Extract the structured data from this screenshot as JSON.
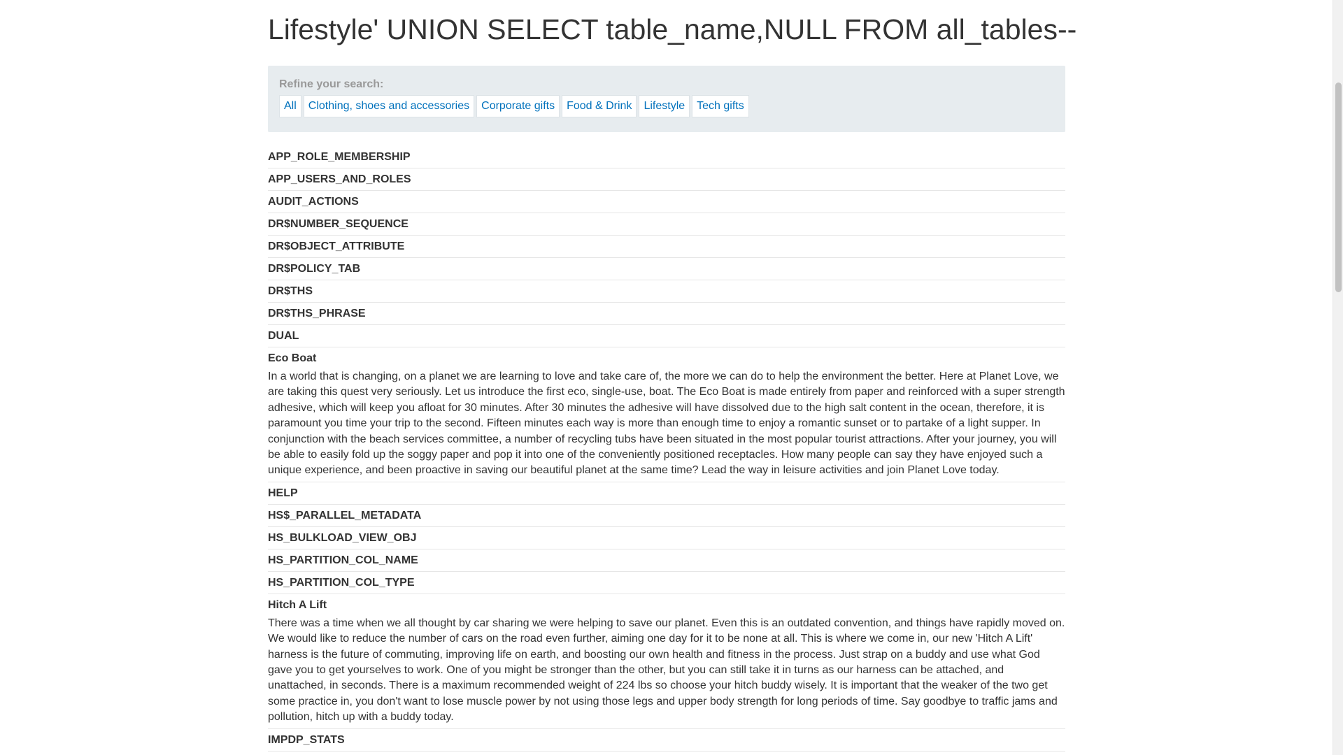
{
  "page": {
    "title": "Lifestyle' UNION SELECT table_name,NULL FROM all_tables--"
  },
  "refine": {
    "label": "Refine your search:",
    "filters": [
      "All",
      "Clothing, shoes and accessories",
      "Corporate gifts",
      "Food & Drink",
      "Lifestyle",
      "Tech gifts"
    ]
  },
  "results": [
    {
      "title": "APP_ROLE_MEMBERSHIP",
      "desc": ""
    },
    {
      "title": "APP_USERS_AND_ROLES",
      "desc": ""
    },
    {
      "title": "AUDIT_ACTIONS",
      "desc": ""
    },
    {
      "title": "DR$NUMBER_SEQUENCE",
      "desc": ""
    },
    {
      "title": "DR$OBJECT_ATTRIBUTE",
      "desc": ""
    },
    {
      "title": "DR$POLICY_TAB",
      "desc": ""
    },
    {
      "title": "DR$THS",
      "desc": ""
    },
    {
      "title": "DR$THS_PHRASE",
      "desc": ""
    },
    {
      "title": "DUAL",
      "desc": ""
    },
    {
      "title": "Eco Boat",
      "desc": "In a world that is changing, on a planet we are learning to love and take care of, the more we can do to help the environment the better. Here at Planet Love, we are taking this quest very seriously. Let us introduce the first eco, single-use, boat. The Eco Boat is made entirely from paper and reinforced with a super strength adhesive, which will keep you afloat for 30 minutes. After 30 minutes the adhesive will have dissolved due to the high salt content in the ocean, therefore, it is paramount you time your trip to the second. Fifteen minutes each way is more than enough time to enjoy a romantic sunset or to partake of a light supper. In conjunction with the beach services committee, a number of recycling tubs have been situated in the most popular tourist attractions. After your journey, you will be able to easily fold up the soggy paper and pop it into one of the conveniently positioned receptacles. How many people can say they have enjoyed such a unique experience, and been proactive in saving our beautiful planet at the same time? Lead the way in leisure activities and join Planet Love today."
    },
    {
      "title": "HELP",
      "desc": ""
    },
    {
      "title": "HS$_PARALLEL_METADATA",
      "desc": ""
    },
    {
      "title": "HS_BULKLOAD_VIEW_OBJ",
      "desc": ""
    },
    {
      "title": "HS_PARTITION_COL_NAME",
      "desc": ""
    },
    {
      "title": "HS_PARTITION_COL_TYPE",
      "desc": ""
    },
    {
      "title": "Hitch A Lift",
      "desc": "There was a time when we all thought by car sharing we were helping to save our planet. Even this is an outdated convention, and things have rapidly moved on. We would like to reduce the number of cars on the road even further, aiming one day for it to be none at all. This is where we come in, our new 'Hitch A Lift' harness is the future of commuting, improving life on earth, and boosting our own health and fitness in the process. Just strap on a buddy and use what God gave you to get yourselves to work. One of you might be stronger than the other, but you can still take it in turns as our harness can be attached, and unattached, in seconds. There is a maximum recommended weight of 224 lbs so choose your hitch buddy wisely. It is important that the weaker of the two get some practice in, you don't want to lose muscle power by not using those legs and upper body strength for long periods of time. Say goodbye to traffic jams and pollution, hitch up with a buddy today."
    },
    {
      "title": "IMPDP_STATS",
      "desc": ""
    }
  ]
}
